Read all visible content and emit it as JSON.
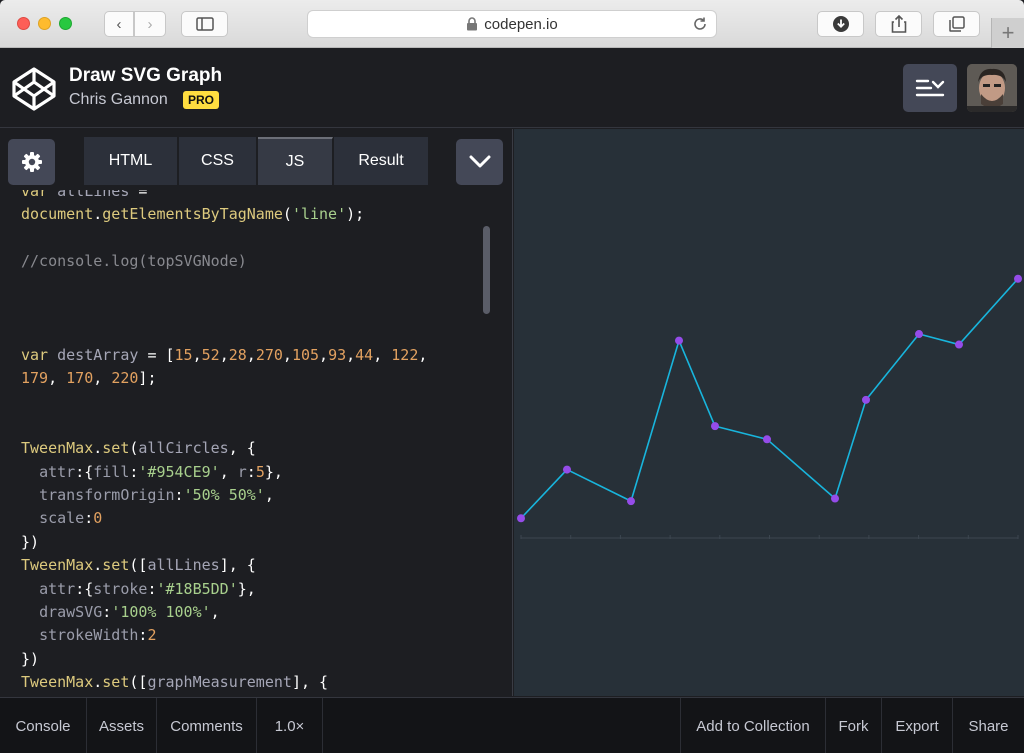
{
  "browser": {
    "url": "codepen.io"
  },
  "header": {
    "title": "Draw SVG Graph",
    "author": "Chris Gannon",
    "badge": "PRO"
  },
  "tabs": [
    {
      "label": "HTML"
    },
    {
      "label": "CSS"
    },
    {
      "label": "JS"
    },
    {
      "label": "Result"
    }
  ],
  "active_tab": "JS",
  "code_lines": [
    "var allLines =",
    "document.getElementsByTagName('line');",
    "",
    "//console.log(topSVGNode)",
    "",
    "",
    "",
    "var destArray = [15,52,28,270,105,93,44, 122,",
    "179, 170, 220];",
    "",
    "",
    "TweenMax.set(allCircles, {",
    "  attr:{fill:'#954CE9', r:5},",
    "  transformOrigin:'50% 50%',",
    "  scale:0",
    "})",
    "TweenMax.set([allLines], {",
    "  attr:{stroke:'#18B5DD'},",
    "  drawSVG:'100% 100%',",
    "  strokeWidth:2",
    "})",
    "TweenMax.set([graphMeasurement], {"
  ],
  "chart_data": {
    "type": "line",
    "values": [
      15,
      52,
      28,
      150,
      85,
      75,
      30,
      105,
      155,
      147,
      197
    ],
    "line_color": "#18B5DD",
    "point_color": "#954CE9",
    "ylim": [
      0,
      250
    ]
  },
  "footer": {
    "left": [
      "Console",
      "Assets",
      "Comments",
      "1.0×"
    ],
    "right": [
      "Add to Collection",
      "Fork",
      "Export",
      "Share"
    ]
  },
  "colors": {
    "background": "#1d1e22",
    "result_bg": "#273038",
    "pro_badge": "#ffdd40"
  }
}
